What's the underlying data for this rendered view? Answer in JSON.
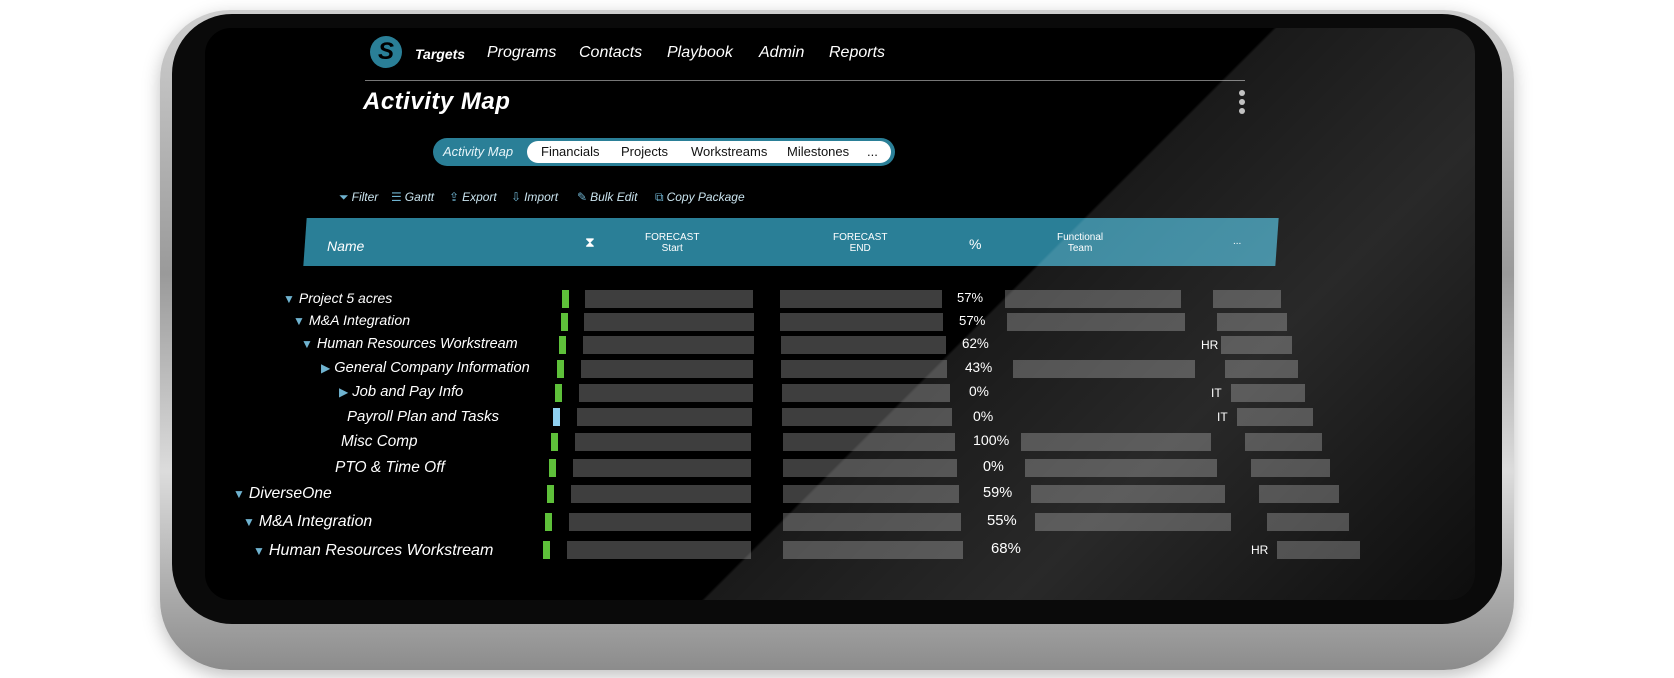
{
  "nav": {
    "logo": "S",
    "items": [
      "Targets",
      "Programs",
      "Contacts",
      "Playbook",
      "Admin",
      "Reports"
    ],
    "active": "Targets"
  },
  "page": {
    "title": "Activity Map"
  },
  "tabs": {
    "active": "Activity Map",
    "items": [
      "Financials",
      "Projects",
      "Workstreams",
      "Milestones",
      "..."
    ]
  },
  "toolbar": {
    "items": [
      {
        "label": "Filter",
        "icon": "filter-icon"
      },
      {
        "label": "Gantt",
        "icon": "gantt-icon"
      },
      {
        "label": "Export",
        "icon": "export-icon"
      },
      {
        "label": "Import",
        "icon": "import-icon"
      },
      {
        "label": "Bulk Edit",
        "icon": "bulk-edit-icon"
      },
      {
        "label": "Copy Package",
        "icon": "copy-package-icon"
      }
    ]
  },
  "table": {
    "columns": {
      "name": "Name",
      "status_icon": "hourglass-icon",
      "forecast_start_1": "FORECAST",
      "forecast_start_2": "Start",
      "forecast_end_1": "FORECAST",
      "forecast_end_2": "END",
      "percent": "%",
      "team_1": "Functional",
      "team_2": "Team",
      "more": "..."
    },
    "rows": [
      {
        "name": "Project 5 acres",
        "expand": "down",
        "status": "green",
        "pct": "57%",
        "team": ""
      },
      {
        "name": "M&A Integration",
        "expand": "down",
        "status": "green",
        "pct": "57%",
        "team": ""
      },
      {
        "name": "Human Resources Workstream",
        "expand": "down",
        "status": "green",
        "pct": "62%",
        "team": "HR"
      },
      {
        "name": "General Company Information",
        "expand": "right",
        "status": "green",
        "pct": "43%",
        "team": ""
      },
      {
        "name": "Job and Pay Info",
        "expand": "right",
        "status": "green",
        "pct": "0%",
        "team": "IT"
      },
      {
        "name": "Payroll Plan and Tasks",
        "expand": "none",
        "status": "blue",
        "pct": "0%",
        "team": "IT"
      },
      {
        "name": "Misc Comp",
        "expand": "none",
        "status": "green",
        "pct": "100%",
        "team": ""
      },
      {
        "name": "PTO & Time Off",
        "expand": "none",
        "status": "green",
        "pct": "0%",
        "team": ""
      },
      {
        "name": "DiverseOne",
        "expand": "down",
        "status": "green",
        "pct": "59%",
        "team": ""
      },
      {
        "name": "M&A Integration",
        "expand": "down",
        "status": "green",
        "pct": "55%",
        "team": ""
      },
      {
        "name": "Human Resources Workstream",
        "expand": "down",
        "status": "green",
        "pct": "68%",
        "team": "HR"
      }
    ]
  },
  "colors": {
    "accent": "#2a7f97",
    "status_green": "#5ec03a",
    "status_blue": "#8fd0f0",
    "bar": "#3e3e3e"
  }
}
